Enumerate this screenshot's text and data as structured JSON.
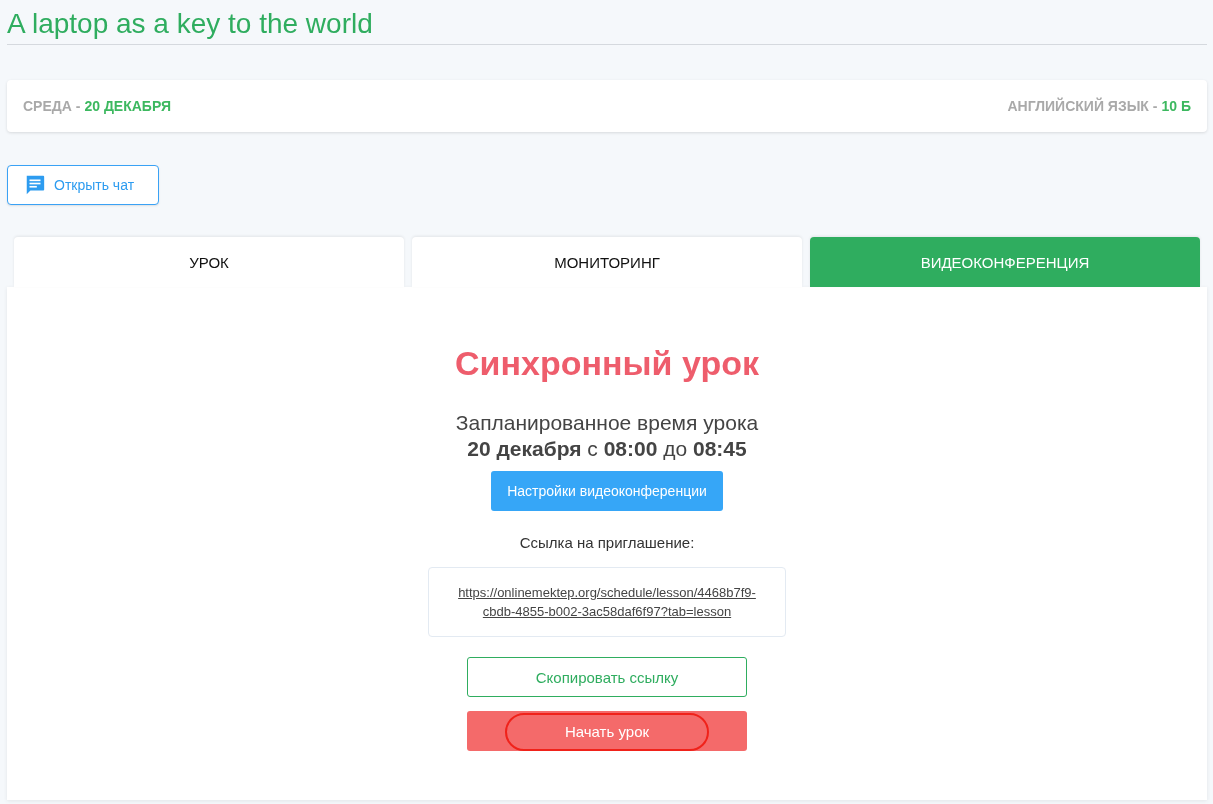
{
  "page_title": "A laptop as a key to the world",
  "info_bar": {
    "day_label": "СРЕДА -",
    "date": "20 ДЕКАБРЯ",
    "subject_label": "АНГЛИЙСКИЙ ЯЗЫК -",
    "class": "10 Б"
  },
  "chat_button": {
    "label": "Открыть чат"
  },
  "tabs": [
    {
      "label": "УРОК",
      "selected": false
    },
    {
      "label": "МОНИТОРИНГ",
      "selected": false
    },
    {
      "label": "ВИДЕОКОНФЕРЕНЦИЯ",
      "selected": true
    }
  ],
  "panel": {
    "heading": "Синхронный урок",
    "schedule_label": "Запланированное время урока",
    "schedule_time": "**20 декабря** с **08:00** до **08:45**",
    "settings_button": "Настройки видеоконференции",
    "invite_label": "Ссылка на приглашение:",
    "invite_link": "https://onlinemektep.org/schedule/lesson/4468b7f9-cbdb-4855-b002-3ac58daf6f97?tab=lesson",
    "copy_button": "Скопировать ссылку",
    "start_button": {
      "label": "Начать урок",
      "highlighted": true
    }
  }
}
